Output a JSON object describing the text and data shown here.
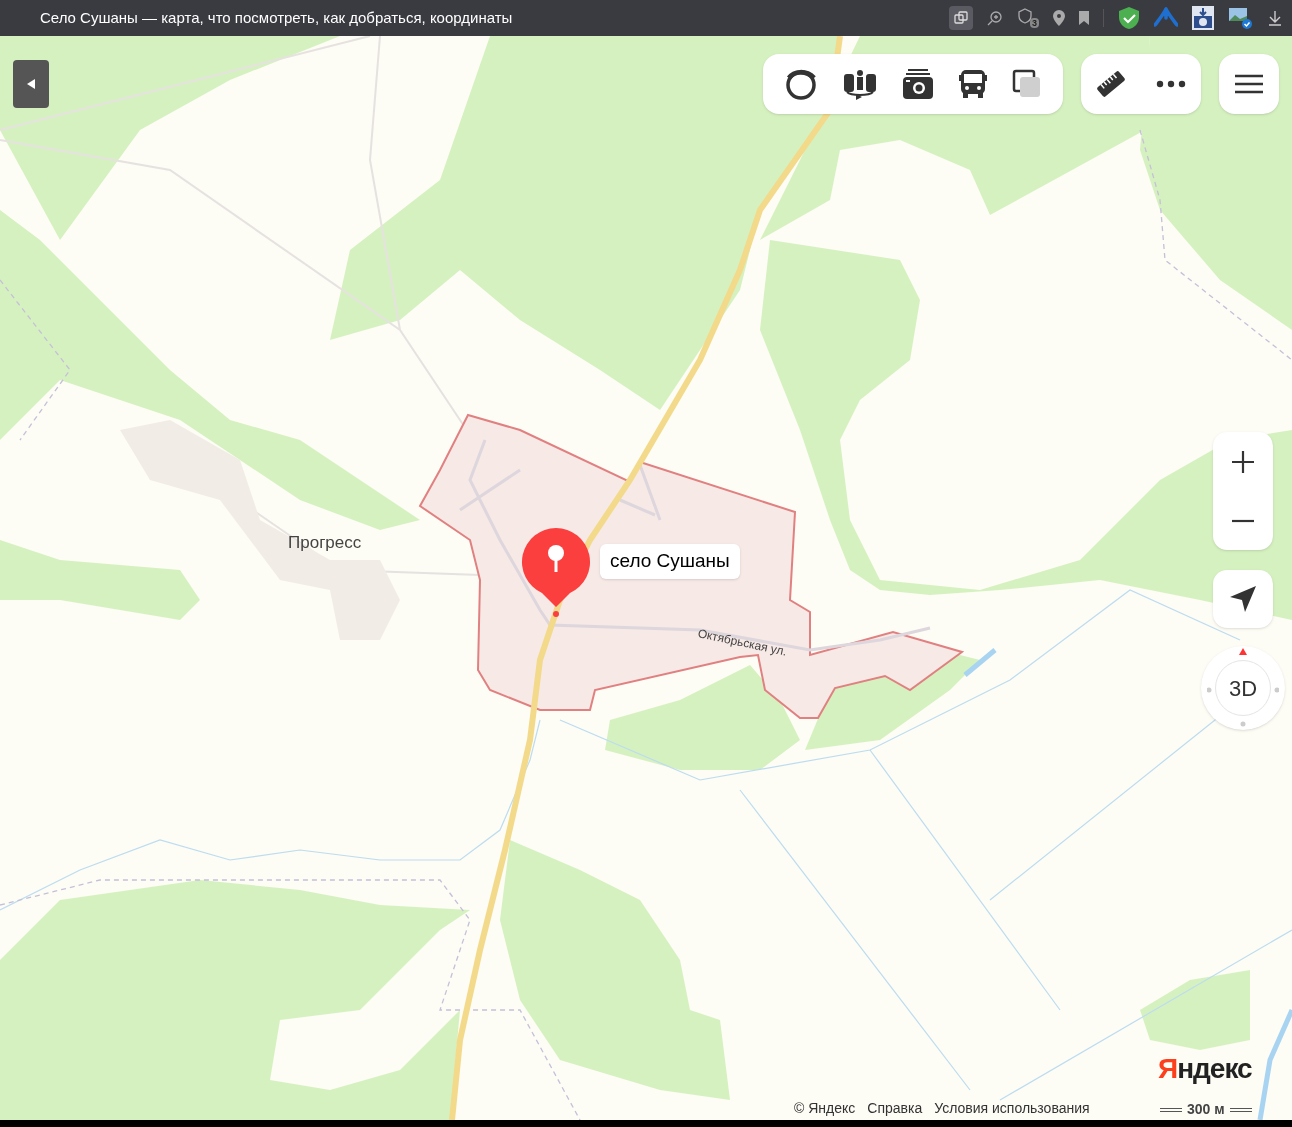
{
  "window": {
    "title": "Село Сушаны — карта, что посмотреть, как добраться, координаты"
  },
  "browser_toolbar": {
    "extensions_badge": "3"
  },
  "map_labels": [
    {
      "kind": "village",
      "text": "Прогресс"
    },
    {
      "kind": "street",
      "text": "Октябрьская ул."
    }
  ],
  "selected_place": {
    "label": "село Сушаны"
  },
  "compass": {
    "label": "3D"
  },
  "logo": "Яндекс",
  "footer_links": [
    "© Яндекс",
    "Справка",
    "Условия использования"
  ],
  "scale": "300 м"
}
